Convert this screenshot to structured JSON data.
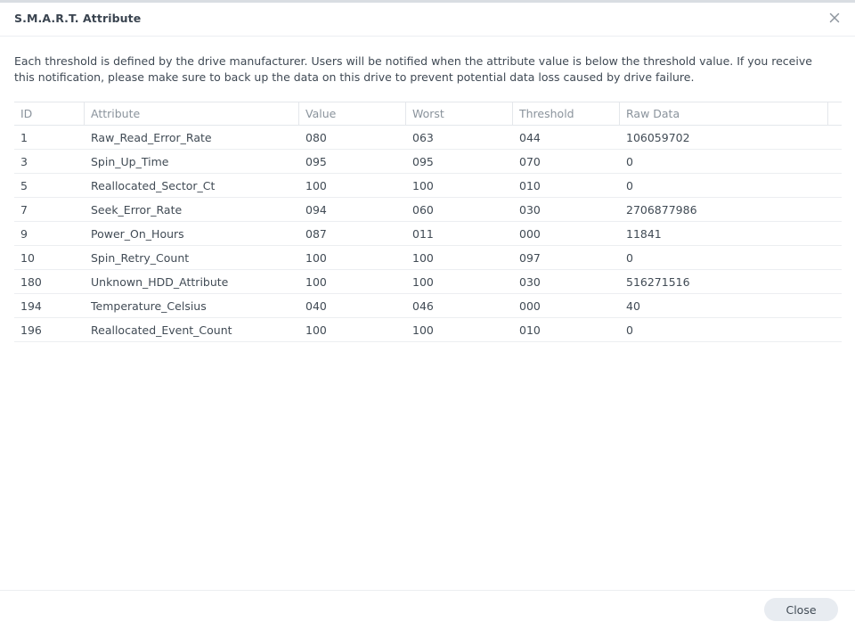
{
  "dialog": {
    "title": "S.M.A.R.T. Attribute",
    "description": "Each threshold is defined by the drive manufacturer. Users will be notified when the attribute value is below the threshold value. If you receive this notification, please make sure to back up the data on this drive to prevent potential data loss caused by drive failure.",
    "close_icon": "close-icon",
    "close_button_label": "Close"
  },
  "table": {
    "columns": {
      "id": "ID",
      "attribute": "Attribute",
      "value": "Value",
      "worst": "Worst",
      "threshold": "Threshold",
      "raw": "Raw Data"
    },
    "rows": [
      {
        "id": "1",
        "attribute": "Raw_Read_Error_Rate",
        "value": "080",
        "worst": "063",
        "threshold": "044",
        "raw": "106059702"
      },
      {
        "id": "3",
        "attribute": "Spin_Up_Time",
        "value": "095",
        "worst": "095",
        "threshold": "070",
        "raw": "0"
      },
      {
        "id": "5",
        "attribute": "Reallocated_Sector_Ct",
        "value": "100",
        "worst": "100",
        "threshold": "010",
        "raw": "0"
      },
      {
        "id": "7",
        "attribute": "Seek_Error_Rate",
        "value": "094",
        "worst": "060",
        "threshold": "030",
        "raw": "2706877986"
      },
      {
        "id": "9",
        "attribute": "Power_On_Hours",
        "value": "087",
        "worst": "011",
        "threshold": "000",
        "raw": "11841"
      },
      {
        "id": "10",
        "attribute": "Spin_Retry_Count",
        "value": "100",
        "worst": "100",
        "threshold": "097",
        "raw": "0"
      },
      {
        "id": "180",
        "attribute": "Unknown_HDD_Attribute",
        "value": "100",
        "worst": "100",
        "threshold": "030",
        "raw": "516271516"
      },
      {
        "id": "194",
        "attribute": "Temperature_Celsius",
        "value": "040",
        "worst": "046",
        "threshold": "000",
        "raw": "40"
      },
      {
        "id": "196",
        "attribute": "Reallocated_Event_Count",
        "value": "100",
        "worst": "100",
        "threshold": "010",
        "raw": "0"
      }
    ]
  }
}
